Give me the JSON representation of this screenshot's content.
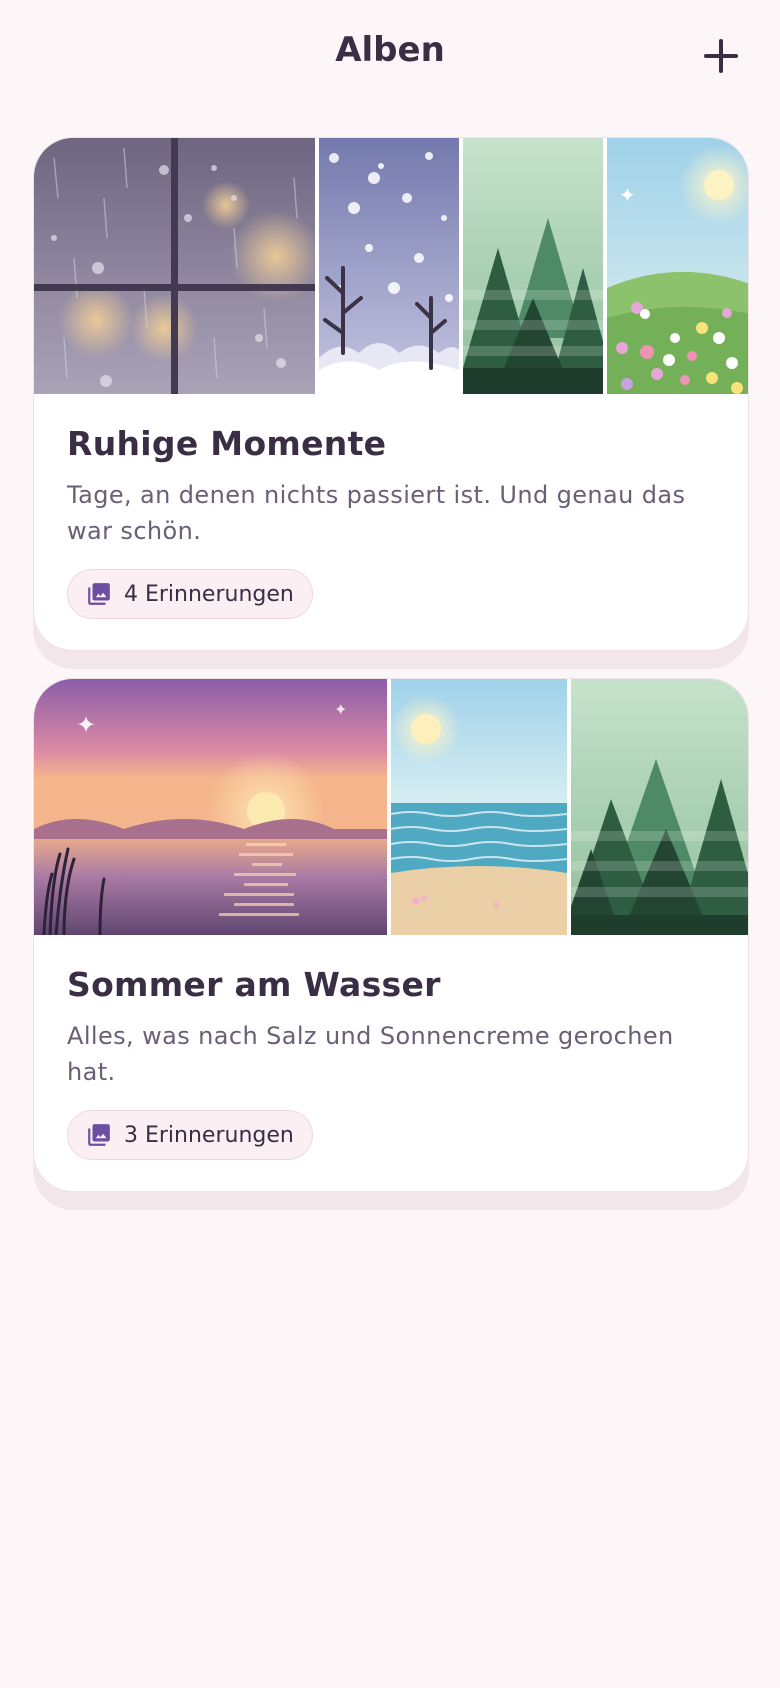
{
  "header": {
    "title": "Alben",
    "add_icon": "plus-icon"
  },
  "albums": [
    {
      "title": "Ruhige Momente",
      "description": "Tage, an denen nichts passiert ist. Und genau das war schön.",
      "count_label": "4 Erinnerungen",
      "photos": [
        "rain-window",
        "snow-trees",
        "forest",
        "flower-meadow"
      ]
    },
    {
      "title": "Sommer am Wasser",
      "description": "Alles, was nach Salz und Sonnencreme gerochen hat.",
      "count_label": "3 Erinnerungen",
      "photos": [
        "sunset-lake",
        "beach",
        "forest"
      ]
    }
  ],
  "colors": {
    "background": "#fdf6f8",
    "text_primary": "#3a2e45",
    "text_secondary": "#6b5f76",
    "accent": "#6c4ea3",
    "badge_bg": "#fbeff3"
  }
}
